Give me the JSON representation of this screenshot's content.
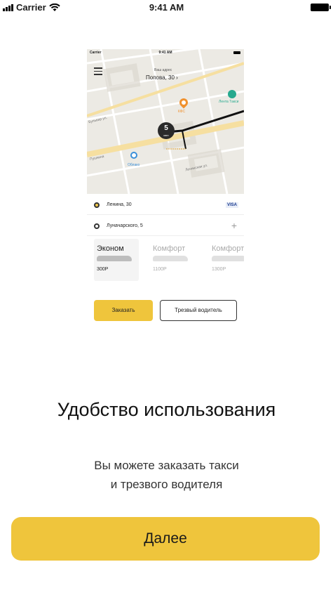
{
  "status_bar": {
    "carrier": "Carrier",
    "time": "9:41 AM"
  },
  "preview": {
    "status_time": "9:41 AM",
    "status_carrier": "Carrier",
    "address_label": "Ваш адрес",
    "address": "Попова, 30",
    "eta_minutes": "5",
    "eta_unit": "мин",
    "map_labels": {
      "poi_orange": "КФС",
      "poi_teal": "Лента Такси",
      "poi_blue": "Облако",
      "street_1": "Бульвар ул.",
      "street_2": "Пушкина",
      "street_3": "Ленинская ул."
    },
    "route": {
      "from": "Ленина, 30",
      "to": "Луначарского, 5",
      "payment": "VISA",
      "add": "+"
    },
    "tariffs": [
      {
        "name": "Эконом",
        "price": "300Р"
      },
      {
        "name": "Комфорт",
        "price": "1100Р"
      },
      {
        "name": "Комфорт",
        "price": "1300Р"
      }
    ],
    "order_button": "Заказать",
    "sober_driver_button": "Трезвый водитель"
  },
  "title": "Удобство использования",
  "subtitle_line1": "Вы можете заказать такси",
  "subtitle_line2": "и трезвого водителя",
  "next_button": "Далее",
  "colors": {
    "accent_yellow": "#efc53c",
    "text_dark": "#111111",
    "text_secondary": "#333333"
  }
}
